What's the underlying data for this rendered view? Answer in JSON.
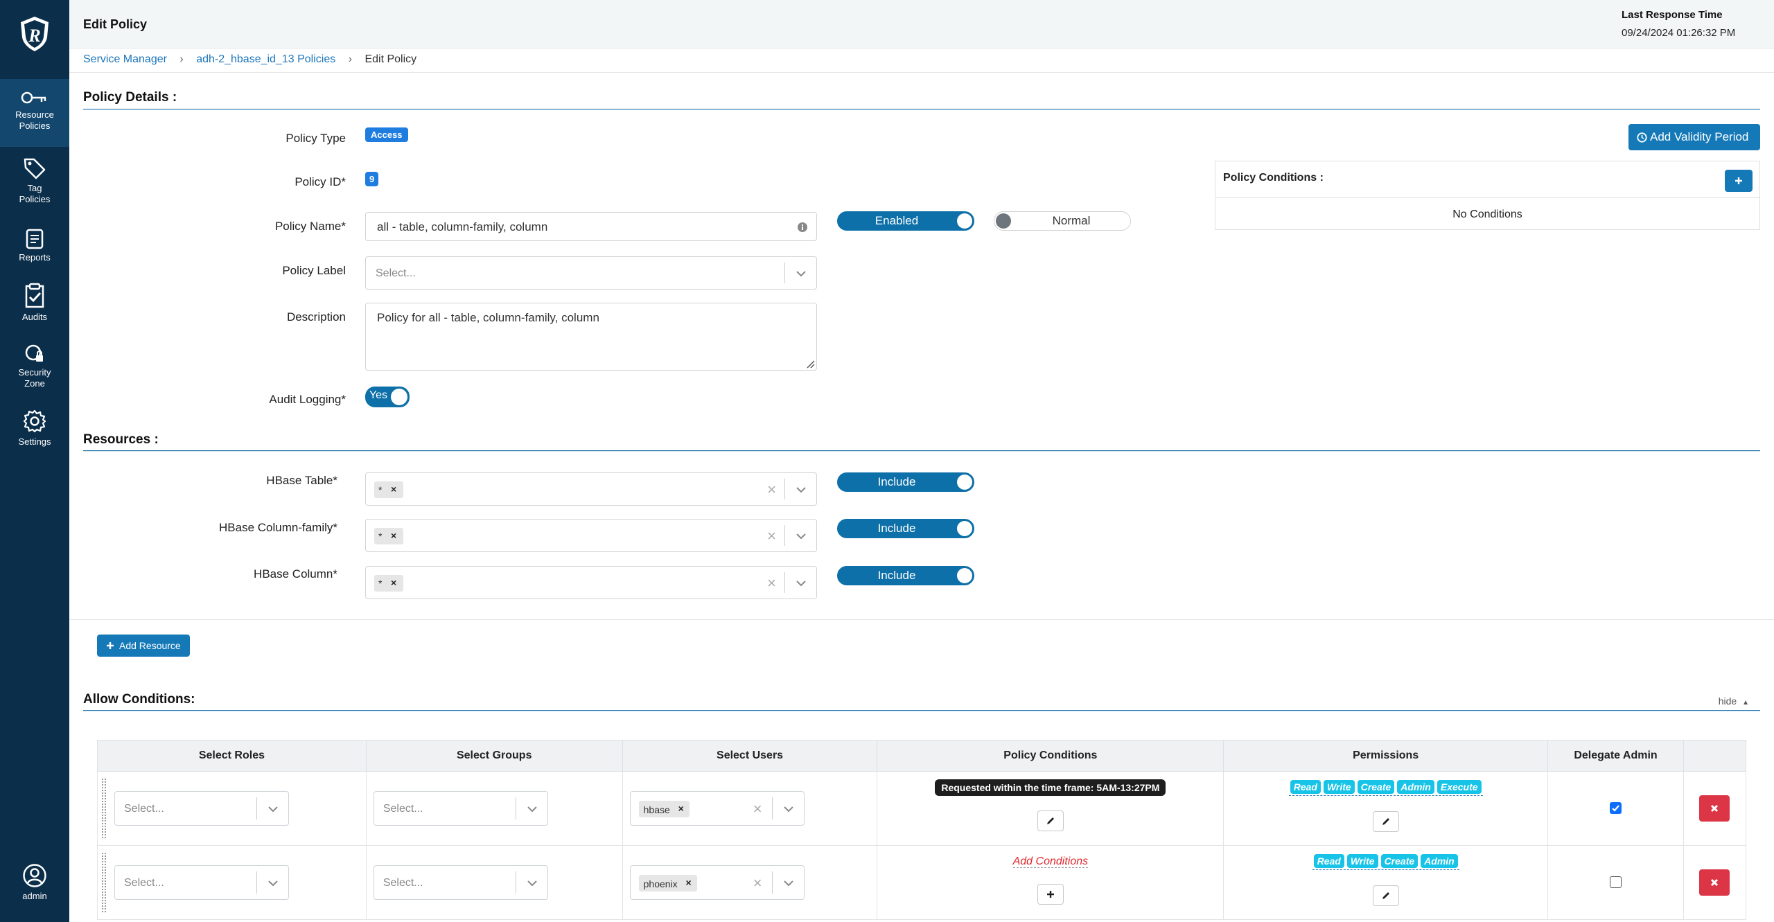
{
  "sidebar": {
    "items": [
      {
        "label_line1": "Resource",
        "label_line2": "Policies"
      },
      {
        "label_line1": "Tag",
        "label_line2": "Policies"
      },
      {
        "label_line1": "Reports",
        "label_line2": ""
      },
      {
        "label_line1": "Audits",
        "label_line2": ""
      },
      {
        "label_line1": "Security",
        "label_line2": "Zone"
      },
      {
        "label_line1": "Settings",
        "label_line2": ""
      }
    ],
    "user_label": "admin"
  },
  "header": {
    "title": "Edit Policy",
    "last_response_label": "Last Response Time",
    "last_response_value": "09/24/2024 01:26:32 PM"
  },
  "breadcrumb": {
    "items": [
      "Service Manager",
      "adh-2_hbase_id_13 Policies",
      "Edit Policy"
    ]
  },
  "policy_details": {
    "title": "Policy Details :",
    "policy_type_label": "Policy Type",
    "policy_type_value": "Access",
    "policy_id_label": "Policy ID*",
    "policy_id_value": "9",
    "policy_name_label": "Policy Name*",
    "policy_name_value": "all - table, column-family, column",
    "enabled_toggle": "Enabled",
    "normal_toggle": "Normal",
    "policy_label_label": "Policy Label",
    "policy_label_placeholder": "Select...",
    "description_label": "Description",
    "description_value": "Policy for all - table, column-family, column",
    "audit_logging_label": "Audit Logging*",
    "audit_logging_value": "Yes",
    "add_validity_label": "Add Validity Period",
    "policy_conditions_title": "Policy Conditions :",
    "no_conditions": "No Conditions"
  },
  "resources": {
    "title": "Resources :",
    "rows": [
      {
        "label": "HBase Table*",
        "chip": "*",
        "toggle": "Include"
      },
      {
        "label": "HBase Column-family*",
        "chip": "*",
        "toggle": "Include"
      },
      {
        "label": "HBase Column*",
        "chip": "*",
        "toggle": "Include"
      }
    ],
    "add_resource": "Add Resource"
  },
  "allow": {
    "title": "Allow Conditions:",
    "hide_label": "hide",
    "columns": [
      "Select Roles",
      "Select Groups",
      "Select Users",
      "Policy Conditions",
      "Permissions",
      "Delegate Admin"
    ],
    "placeholder": "Select...",
    "rows": [
      {
        "user": "hbase",
        "condition": "Requested within the time frame: 5AM-13:27PM",
        "permissions": [
          "Read",
          "Write",
          "Create",
          "Admin",
          "Execute"
        ],
        "delegate": true
      },
      {
        "user": "phoenix",
        "condition": "Add Conditions",
        "permissions": [
          "Read",
          "Write",
          "Create",
          "Admin"
        ],
        "delegate": false
      }
    ]
  },
  "colors": {
    "sidebar": "#0b2e4a",
    "primary": "#1579b8",
    "badge": "#1f7de0",
    "perm": "#17c4e8",
    "danger": "#dc3545"
  }
}
